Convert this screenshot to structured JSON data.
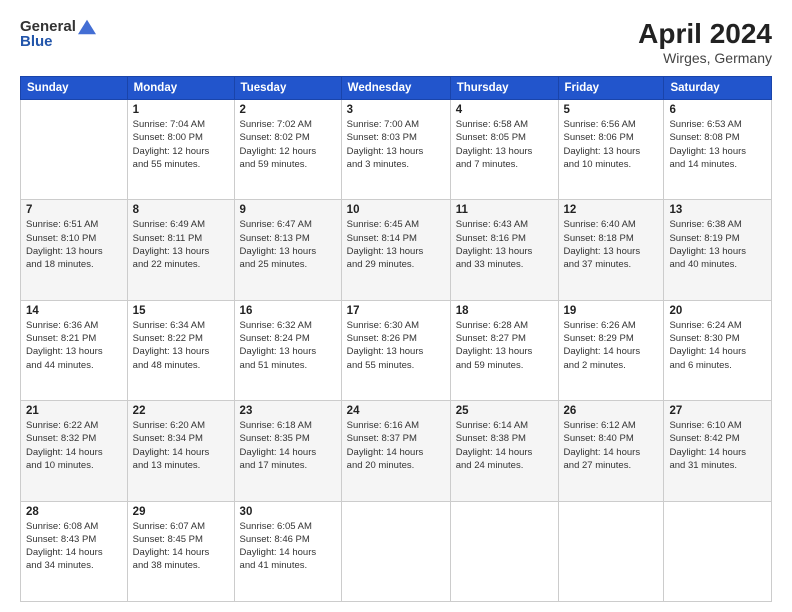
{
  "header": {
    "logo_general": "General",
    "logo_blue": "Blue",
    "title": "April 2024",
    "location": "Wirges, Germany"
  },
  "days_of_week": [
    "Sunday",
    "Monday",
    "Tuesday",
    "Wednesday",
    "Thursday",
    "Friday",
    "Saturday"
  ],
  "weeks": [
    [
      {
        "day": "",
        "info": ""
      },
      {
        "day": "1",
        "info": "Sunrise: 7:04 AM\nSunset: 8:00 PM\nDaylight: 12 hours\nand 55 minutes."
      },
      {
        "day": "2",
        "info": "Sunrise: 7:02 AM\nSunset: 8:02 PM\nDaylight: 12 hours\nand 59 minutes."
      },
      {
        "day": "3",
        "info": "Sunrise: 7:00 AM\nSunset: 8:03 PM\nDaylight: 13 hours\nand 3 minutes."
      },
      {
        "day": "4",
        "info": "Sunrise: 6:58 AM\nSunset: 8:05 PM\nDaylight: 13 hours\nand 7 minutes."
      },
      {
        "day": "5",
        "info": "Sunrise: 6:56 AM\nSunset: 8:06 PM\nDaylight: 13 hours\nand 10 minutes."
      },
      {
        "day": "6",
        "info": "Sunrise: 6:53 AM\nSunset: 8:08 PM\nDaylight: 13 hours\nand 14 minutes."
      }
    ],
    [
      {
        "day": "7",
        "info": "Sunrise: 6:51 AM\nSunset: 8:10 PM\nDaylight: 13 hours\nand 18 minutes."
      },
      {
        "day": "8",
        "info": "Sunrise: 6:49 AM\nSunset: 8:11 PM\nDaylight: 13 hours\nand 22 minutes."
      },
      {
        "day": "9",
        "info": "Sunrise: 6:47 AM\nSunset: 8:13 PM\nDaylight: 13 hours\nand 25 minutes."
      },
      {
        "day": "10",
        "info": "Sunrise: 6:45 AM\nSunset: 8:14 PM\nDaylight: 13 hours\nand 29 minutes."
      },
      {
        "day": "11",
        "info": "Sunrise: 6:43 AM\nSunset: 8:16 PM\nDaylight: 13 hours\nand 33 minutes."
      },
      {
        "day": "12",
        "info": "Sunrise: 6:40 AM\nSunset: 8:18 PM\nDaylight: 13 hours\nand 37 minutes."
      },
      {
        "day": "13",
        "info": "Sunrise: 6:38 AM\nSunset: 8:19 PM\nDaylight: 13 hours\nand 40 minutes."
      }
    ],
    [
      {
        "day": "14",
        "info": "Sunrise: 6:36 AM\nSunset: 8:21 PM\nDaylight: 13 hours\nand 44 minutes."
      },
      {
        "day": "15",
        "info": "Sunrise: 6:34 AM\nSunset: 8:22 PM\nDaylight: 13 hours\nand 48 minutes."
      },
      {
        "day": "16",
        "info": "Sunrise: 6:32 AM\nSunset: 8:24 PM\nDaylight: 13 hours\nand 51 minutes."
      },
      {
        "day": "17",
        "info": "Sunrise: 6:30 AM\nSunset: 8:26 PM\nDaylight: 13 hours\nand 55 minutes."
      },
      {
        "day": "18",
        "info": "Sunrise: 6:28 AM\nSunset: 8:27 PM\nDaylight: 13 hours\nand 59 minutes."
      },
      {
        "day": "19",
        "info": "Sunrise: 6:26 AM\nSunset: 8:29 PM\nDaylight: 14 hours\nand 2 minutes."
      },
      {
        "day": "20",
        "info": "Sunrise: 6:24 AM\nSunset: 8:30 PM\nDaylight: 14 hours\nand 6 minutes."
      }
    ],
    [
      {
        "day": "21",
        "info": "Sunrise: 6:22 AM\nSunset: 8:32 PM\nDaylight: 14 hours\nand 10 minutes."
      },
      {
        "day": "22",
        "info": "Sunrise: 6:20 AM\nSunset: 8:34 PM\nDaylight: 14 hours\nand 13 minutes."
      },
      {
        "day": "23",
        "info": "Sunrise: 6:18 AM\nSunset: 8:35 PM\nDaylight: 14 hours\nand 17 minutes."
      },
      {
        "day": "24",
        "info": "Sunrise: 6:16 AM\nSunset: 8:37 PM\nDaylight: 14 hours\nand 20 minutes."
      },
      {
        "day": "25",
        "info": "Sunrise: 6:14 AM\nSunset: 8:38 PM\nDaylight: 14 hours\nand 24 minutes."
      },
      {
        "day": "26",
        "info": "Sunrise: 6:12 AM\nSunset: 8:40 PM\nDaylight: 14 hours\nand 27 minutes."
      },
      {
        "day": "27",
        "info": "Sunrise: 6:10 AM\nSunset: 8:42 PM\nDaylight: 14 hours\nand 31 minutes."
      }
    ],
    [
      {
        "day": "28",
        "info": "Sunrise: 6:08 AM\nSunset: 8:43 PM\nDaylight: 14 hours\nand 34 minutes."
      },
      {
        "day": "29",
        "info": "Sunrise: 6:07 AM\nSunset: 8:45 PM\nDaylight: 14 hours\nand 38 minutes."
      },
      {
        "day": "30",
        "info": "Sunrise: 6:05 AM\nSunset: 8:46 PM\nDaylight: 14 hours\nand 41 minutes."
      },
      {
        "day": "",
        "info": ""
      },
      {
        "day": "",
        "info": ""
      },
      {
        "day": "",
        "info": ""
      },
      {
        "day": "",
        "info": ""
      }
    ]
  ]
}
